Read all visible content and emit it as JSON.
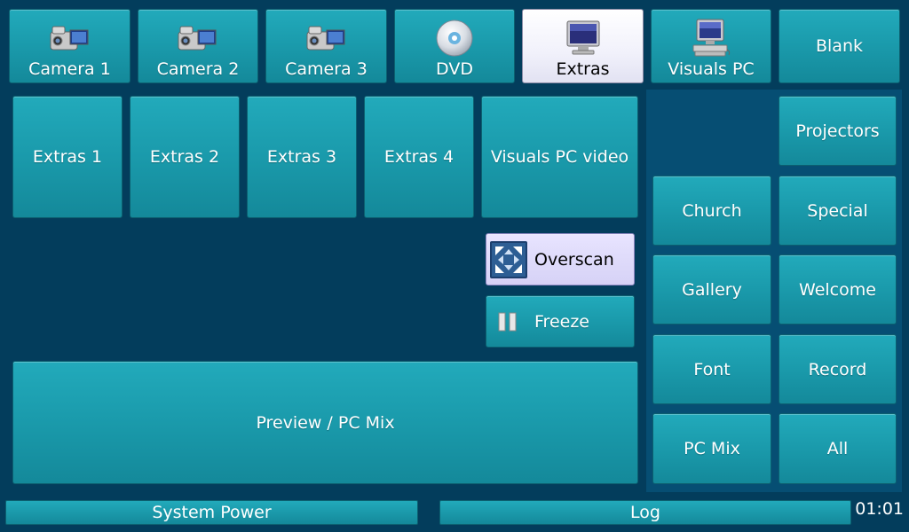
{
  "sources": [
    {
      "label": "Camera 1",
      "icon": "video-camera-icon"
    },
    {
      "label": "Camera 2",
      "icon": "video-camera-icon"
    },
    {
      "label": "Camera 3",
      "icon": "video-camera-icon"
    },
    {
      "label": "DVD",
      "icon": "disc-icon"
    },
    {
      "label": "Extras",
      "icon": "monitor-icon",
      "selected": true
    },
    {
      "label": "Visuals PC",
      "icon": "computer-icon"
    },
    {
      "label": "Blank"
    }
  ],
  "extras": [
    "Extras 1",
    "Extras 2",
    "Extras 3",
    "Extras 4",
    "Visuals PC video"
  ],
  "controls": {
    "overscan": {
      "label": "Overscan",
      "icon": "expand-arrows-icon"
    },
    "freeze": {
      "label": "Freeze",
      "icon": "pause-icon"
    }
  },
  "preview_label": "Preview / PC Mix",
  "presets": {
    "projectors": "Projectors",
    "church": "Church",
    "special": "Special",
    "gallery": "Gallery",
    "welcome": "Welcome",
    "font": "Font",
    "record": "Record",
    "pc_mix": "PC Mix",
    "all": "All"
  },
  "footer": {
    "system_power": "System Power",
    "log": "Log",
    "clock": "01:01"
  },
  "colors": {
    "background": "#033d5c",
    "panel": "#064e73",
    "button_teal": "#1a9aab",
    "selected_button": "#f1f1fb",
    "overscan_button": "#d6d2f6"
  }
}
